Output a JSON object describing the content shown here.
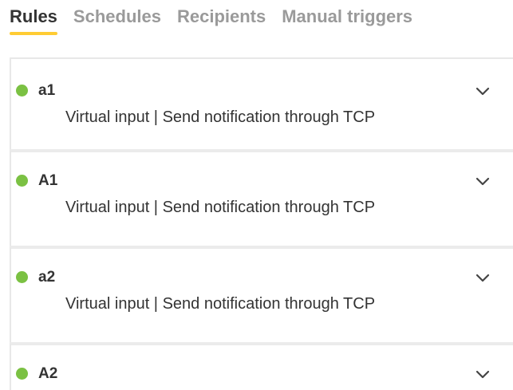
{
  "tabs": [
    {
      "label": "Rules",
      "active": true
    },
    {
      "label": "Schedules",
      "active": false
    },
    {
      "label": "Recipients",
      "active": false
    },
    {
      "label": "Manual triggers",
      "active": false
    }
  ],
  "rules": [
    {
      "name": "a1",
      "description": "Virtual input | Send notification through TCP",
      "status_color": "#7bc143",
      "expand_icon": "chevron-down-icon"
    },
    {
      "name": "A1",
      "description": "Virtual input | Send notification through TCP",
      "status_color": "#7bc143",
      "expand_icon": "chevron-down-icon"
    },
    {
      "name": "a2",
      "description": "Virtual input | Send notification through TCP",
      "status_color": "#7bc143",
      "expand_icon": "chevron-down-icon"
    },
    {
      "name": "A2",
      "description": "",
      "status_color": "#7bc143",
      "expand_icon": "chevron-down-icon"
    }
  ],
  "colors": {
    "accent_underline": "#ffcc33",
    "status_enabled": "#7bc143",
    "inactive_tab": "#9a9a9a",
    "text": "#333333"
  }
}
